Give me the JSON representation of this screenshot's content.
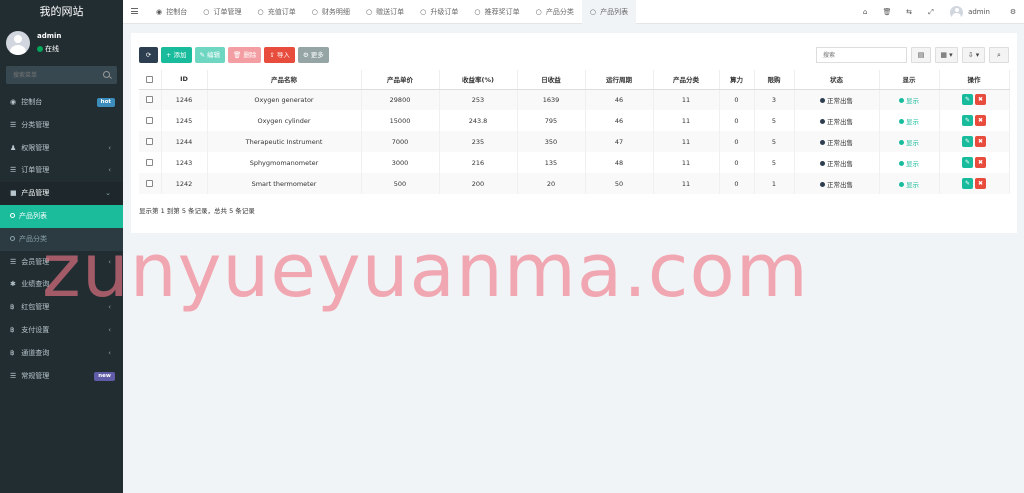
{
  "site": {
    "title": "我的网站"
  },
  "user": {
    "name": "admin",
    "status": "在线"
  },
  "sidebar": {
    "search_placeholder": "搜索菜单",
    "items": [
      {
        "icon": "dashboard-icon",
        "glyph": "◉",
        "label": "控制台",
        "badge": "hot"
      },
      {
        "icon": "list-icon",
        "glyph": "☰",
        "label": "分类管理"
      },
      {
        "icon": "group-icon",
        "glyph": "♟",
        "label": "权限管理",
        "arrow": "‹"
      },
      {
        "icon": "list-icon",
        "glyph": "☰",
        "label": "订单管理",
        "arrow": "‹"
      },
      {
        "icon": "cube-icon",
        "glyph": "■",
        "label": "产品管理",
        "arrow": "⌄"
      },
      {
        "label": "产品列表"
      },
      {
        "label": "产品分类"
      },
      {
        "icon": "list-icon",
        "glyph": "☰",
        "label": "会员管理",
        "arrow": "‹"
      },
      {
        "icon": "gear-icon",
        "glyph": "✱",
        "label": "业绩查询"
      },
      {
        "icon": "bitcoin-icon",
        "glyph": "฿",
        "label": "红包管理",
        "arrow": "‹"
      },
      {
        "icon": "bitcoin-icon",
        "glyph": "฿",
        "label": "支付设置",
        "arrow": "‹"
      },
      {
        "icon": "bitcoin-icon",
        "glyph": "฿",
        "label": "通道查询",
        "arrow": "‹"
      },
      {
        "icon": "list-icon",
        "glyph": "☰",
        "label": "常规管理",
        "badge": "new"
      }
    ]
  },
  "tabs": [
    {
      "icon": "dashboard-icon",
      "glyph": "◉",
      "label": "控制台"
    },
    {
      "icon": "circle-icon",
      "glyph": "○",
      "label": "订单管理"
    },
    {
      "icon": "circle-icon",
      "glyph": "○",
      "label": "充值订单"
    },
    {
      "icon": "circle-icon",
      "glyph": "○",
      "label": "财务明细"
    },
    {
      "icon": "circle-icon",
      "glyph": "○",
      "label": "赠送订单"
    },
    {
      "icon": "circle-icon",
      "glyph": "○",
      "label": "升级订单"
    },
    {
      "icon": "circle-icon",
      "glyph": "○",
      "label": "推荐奖订单"
    },
    {
      "icon": "circle-icon",
      "glyph": "○",
      "label": "产品分类"
    },
    {
      "icon": "circle-icon",
      "glyph": "○",
      "label": "产品列表"
    }
  ],
  "topbar": {
    "icons": [
      {
        "name": "home-icon",
        "glyph": "⌂"
      },
      {
        "name": "trash-icon",
        "glyph": "🗑"
      },
      {
        "name": "language-icon",
        "glyph": "⇆"
      },
      {
        "name": "fullscreen-icon",
        "glyph": "⤢"
      }
    ],
    "user": "admin",
    "settings_glyph": "⚙"
  },
  "toolbar": {
    "refresh": "⟳",
    "add": "+ 添加",
    "edit": "✎ 编辑",
    "delete": "🗑 删除",
    "import": "⇪ 导入",
    "more": "⚙ 更多",
    "search_placeholder": "搜索",
    "view_glyph": "▤",
    "columns_glyph": "▦ ▾",
    "export_glyph": "⇩ ▾",
    "search_glyph": "⌕"
  },
  "table": {
    "headers": [
      "",
      "ID",
      "产品名称",
      "产品单价",
      "收益率(%)",
      "日收益",
      "运行周期",
      "产品分类",
      "算力",
      "限购",
      "状态",
      "显示",
      "操作"
    ],
    "rows": [
      {
        "id": "1246",
        "name": "Oxygen generator",
        "price": "29800",
        "rate": "253",
        "daily": "1639",
        "cycle": "46",
        "category": "11",
        "power": "0",
        "limit": "3",
        "status": "正常出售",
        "show": "显示"
      },
      {
        "id": "1245",
        "name": "Oxygen cylinder",
        "price": "15000",
        "rate": "243.8",
        "daily": "795",
        "cycle": "46",
        "category": "11",
        "power": "0",
        "limit": "5",
        "status": "正常出售",
        "show": "显示"
      },
      {
        "id": "1244",
        "name": "Therapeutic Instrument",
        "price": "7000",
        "rate": "235",
        "daily": "350",
        "cycle": "47",
        "category": "11",
        "power": "0",
        "limit": "5",
        "status": "正常出售",
        "show": "显示"
      },
      {
        "id": "1243",
        "name": "Sphygmomanometer",
        "price": "3000",
        "rate": "216",
        "daily": "135",
        "cycle": "48",
        "category": "11",
        "power": "0",
        "limit": "5",
        "status": "正常出售",
        "show": "显示"
      },
      {
        "id": "1242",
        "name": "Smart thermometer",
        "price": "500",
        "rate": "200",
        "daily": "20",
        "cycle": "50",
        "category": "11",
        "power": "0",
        "limit": "1",
        "status": "正常出售",
        "show": "显示"
      }
    ],
    "summary": "显示第 1 到第 5 条记录，总共 5 条记录"
  },
  "watermark": "zunyueyuanma.com",
  "colors": {
    "sidebar_bg": "#222d32",
    "accent": "#18bc9c",
    "danger": "#e74c3c",
    "primary_dark": "#2c3e50"
  }
}
